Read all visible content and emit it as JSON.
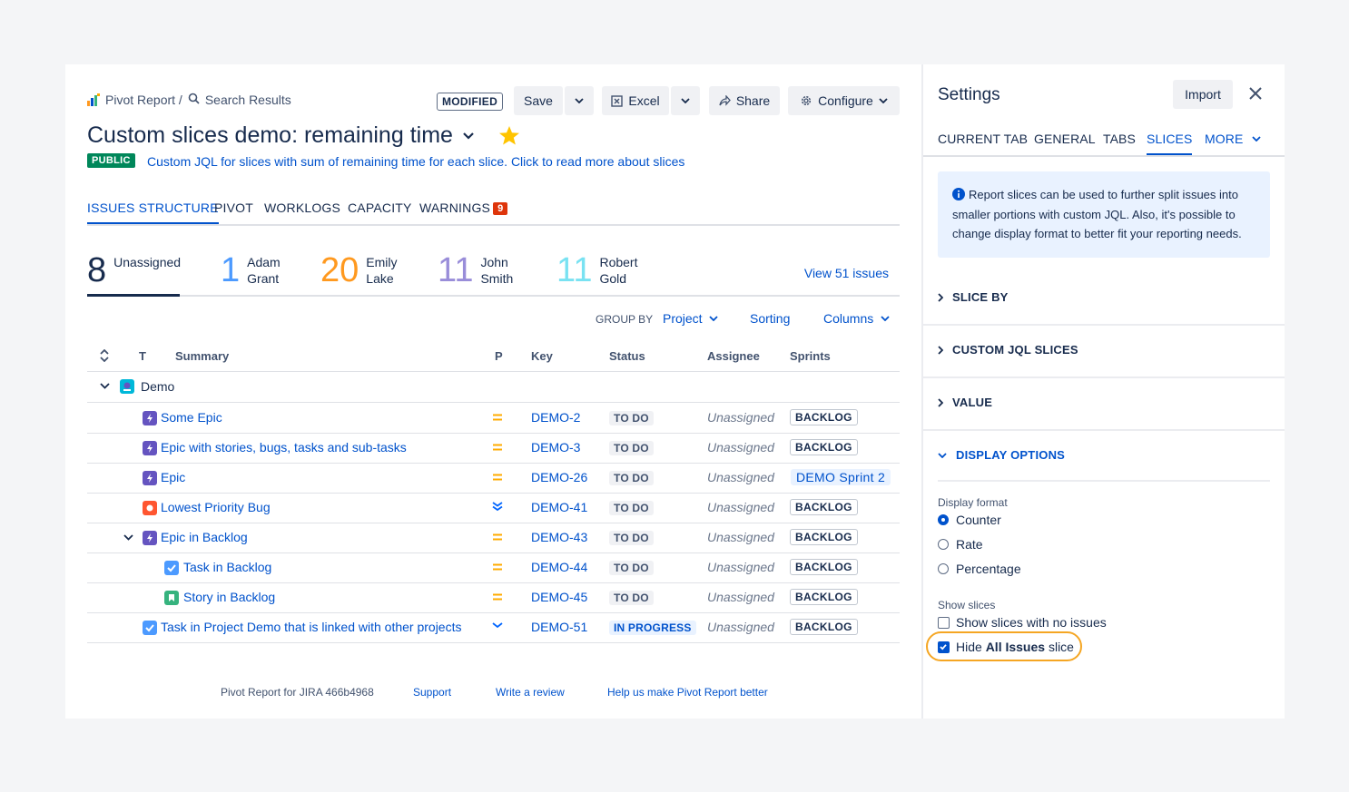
{
  "breadcrumb": {
    "app": "Pivot Report /",
    "page": "Search Results"
  },
  "toolbar": {
    "modified": "MODIFIED",
    "save": "Save",
    "excel": "Excel",
    "share": "Share",
    "configure": "Configure"
  },
  "report": {
    "title": "Custom slices demo: remaining time",
    "visibility": "PUBLIC",
    "description": "Custom JQL for slices with sum of remaining time for each slice. Click to read more about slices"
  },
  "tabs": [
    {
      "label": "ISSUES STRUCTURE"
    },
    {
      "label": "PIVOT"
    },
    {
      "label": "WORKLOGS"
    },
    {
      "label": "CAPACITY"
    },
    {
      "label": "WARNINGS",
      "badge": "9"
    }
  ],
  "counters": [
    {
      "value": "8",
      "name": "Unassigned",
      "color": "#172b4d"
    },
    {
      "value": "1",
      "first": "Adam",
      "last": "Grant",
      "color": "#4c9aff"
    },
    {
      "value": "20",
      "first": "Emily",
      "last": "Lake",
      "color": "#ff991f"
    },
    {
      "value": "11",
      "first": "John",
      "last": "Smith",
      "color": "#998dd9"
    },
    {
      "value": "11",
      "first": "Robert",
      "last": "Gold",
      "color": "#79e2f2"
    }
  ],
  "view_issues": "View 51 issues",
  "grouping": {
    "label": "GROUP BY",
    "value": "Project",
    "sorting": "Sorting",
    "columns": "Columns"
  },
  "columns": {
    "type": "T",
    "summary": "Summary",
    "priority": "P",
    "key": "Key",
    "status": "Status",
    "assignee": "Assignee",
    "sprints": "Sprints"
  },
  "project_group": "Demo",
  "rows": [
    {
      "summary": "Some Epic",
      "type": "epic",
      "priority": "medium",
      "key": "DEMO-2",
      "status": "TO DO",
      "assignee": "Unassigned",
      "sprint": "BACKLOG"
    },
    {
      "summary": "Epic with stories, bugs, tasks and sub-tasks",
      "type": "epic",
      "priority": "medium",
      "key": "DEMO-3",
      "status": "TO DO",
      "assignee": "Unassigned",
      "sprint": "BACKLOG"
    },
    {
      "summary": "Epic",
      "type": "epic",
      "priority": "medium",
      "key": "DEMO-26",
      "status": "TO DO",
      "assignee": "Unassigned",
      "sprint": "DEMO Sprint 2"
    },
    {
      "summary": "Lowest Priority Bug",
      "type": "bug",
      "priority": "lowest",
      "key": "DEMO-41",
      "status": "TO DO",
      "assignee": "Unassigned",
      "sprint": "BACKLOG"
    },
    {
      "summary": "Epic in Backlog",
      "type": "epic",
      "priority": "medium",
      "key": "DEMO-43",
      "status": "TO DO",
      "assignee": "Unassigned",
      "sprint": "BACKLOG"
    },
    {
      "summary": "Task in Backlog",
      "type": "task",
      "priority": "medium",
      "key": "DEMO-44",
      "status": "TO DO",
      "assignee": "Unassigned",
      "sprint": "BACKLOG"
    },
    {
      "summary": "Story in Backlog",
      "type": "story",
      "priority": "medium",
      "key": "DEMO-45",
      "status": "TO DO",
      "assignee": "Unassigned",
      "sprint": "BACKLOG"
    },
    {
      "summary": "Task in Project Demo that is linked with other projects",
      "type": "task",
      "priority": "low",
      "key": "DEMO-51",
      "status": "IN PROGRESS",
      "assignee": "Unassigned",
      "sprint": "BACKLOG"
    }
  ],
  "footer": {
    "version": "Pivot Report for JIRA 466b4968",
    "support": "Support",
    "review": "Write a review",
    "feedback": "Help us make Pivot Report better"
  },
  "settings": {
    "title": "Settings",
    "import": "Import",
    "tabs": [
      "CURRENT TAB",
      "GENERAL",
      "TABS",
      "SLICES",
      "MORE"
    ],
    "info": "Report slices can be used to further split issues into smaller portions with custom JQL. Also, it's possible to change display format to better fit your reporting needs.",
    "sections": [
      "SLICE BY",
      "CUSTOM JQL SLICES",
      "VALUE",
      "DISPLAY OPTIONS"
    ],
    "display_format_label": "Display format",
    "formats": [
      "Counter",
      "Rate",
      "Percentage"
    ],
    "selected_format": "Counter",
    "show_slices_label": "Show slices",
    "show_empty": "Show slices with no issues",
    "show_empty_checked": false,
    "hide_all_pre": "Hide ",
    "hide_all_bold": "All Issues",
    "hide_all_post": " slice",
    "hide_all_checked": true
  },
  "colors": {
    "accent": "#0052cc",
    "public": "#00875a",
    "warning_badge": "#de350b",
    "highlight": "#f5a623"
  }
}
